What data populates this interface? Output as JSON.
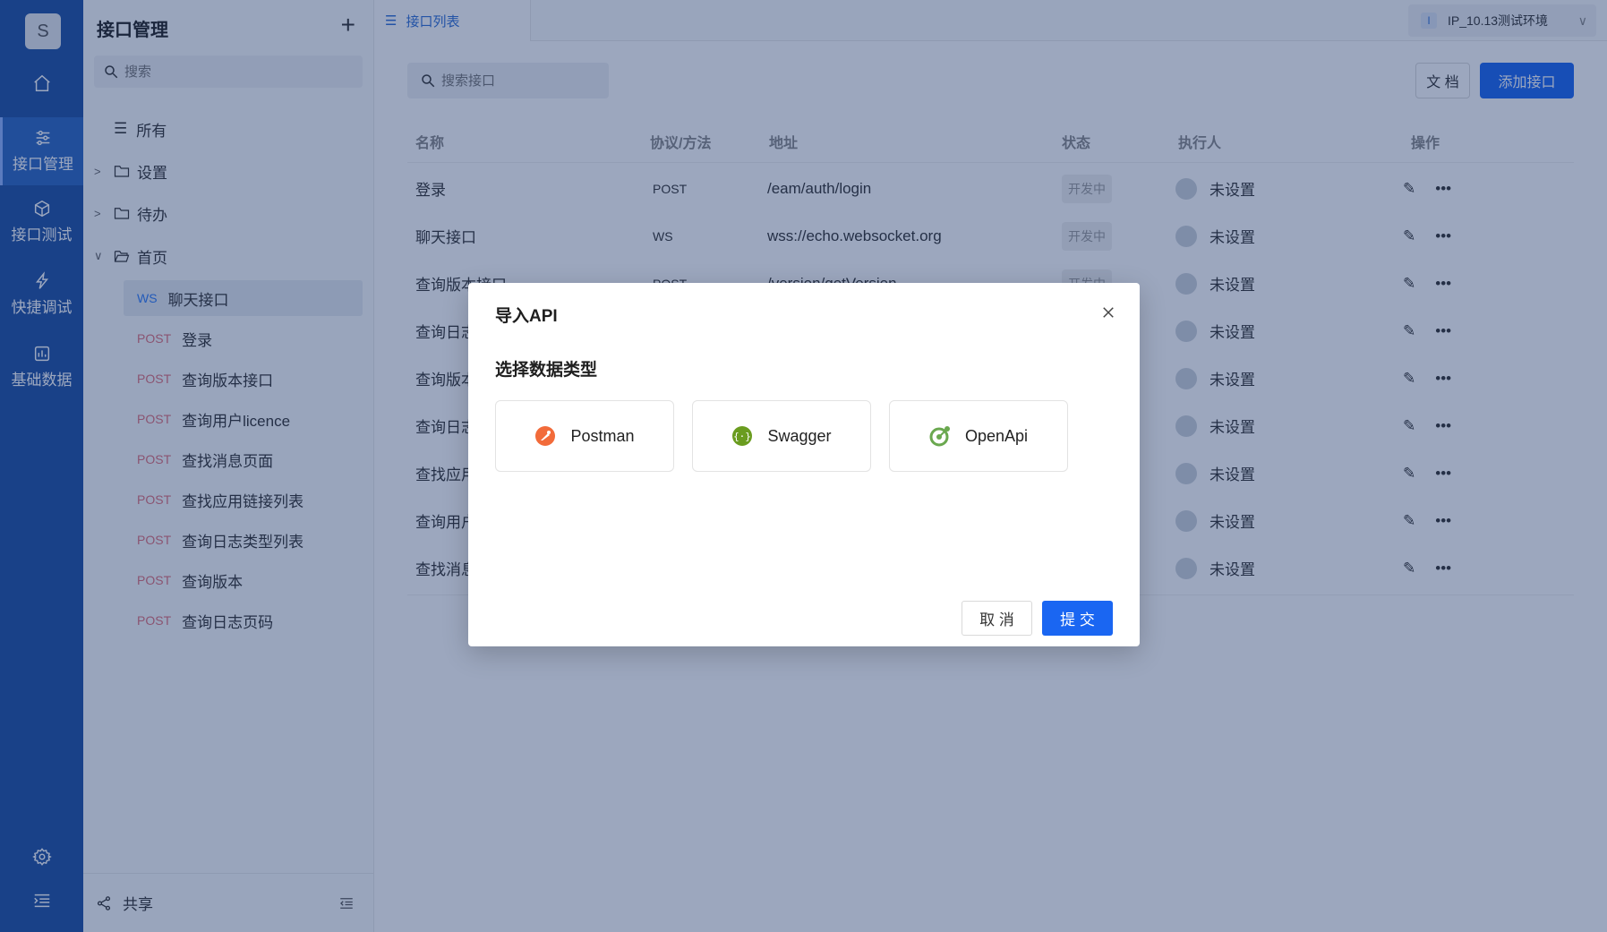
{
  "rail": {
    "avatar": "S",
    "items": [
      {
        "label": "接口管理"
      },
      {
        "label": "接口测试"
      },
      {
        "label": "快捷调试"
      },
      {
        "label": "基础数据"
      }
    ]
  },
  "side": {
    "title": "接口管理",
    "search_placeholder": "搜索",
    "all_label": "所有",
    "folders": [
      "设置",
      "待办",
      "首页"
    ],
    "apis": [
      {
        "method": "WS",
        "name": "聊天接口"
      },
      {
        "method": "POST",
        "name": "登录"
      },
      {
        "method": "POST",
        "name": "查询版本接口"
      },
      {
        "method": "POST",
        "name": "查询用户licence"
      },
      {
        "method": "POST",
        "name": "查找消息页面"
      },
      {
        "method": "POST",
        "name": "查找应用链接列表"
      },
      {
        "method": "POST",
        "name": "查询日志类型列表"
      },
      {
        "method": "POST",
        "name": "查询版本"
      },
      {
        "method": "POST",
        "name": "查询日志页码"
      }
    ],
    "footer_share": "共享"
  },
  "topbar": {
    "tab_label": "接口列表",
    "env_badge": "I",
    "env_label": "IP_10.13测试环境"
  },
  "main": {
    "search_placeholder": "搜索接口",
    "doc_button": "文 档",
    "add_button": "添加接口",
    "headers": {
      "name": "名称",
      "method": "协议/方法",
      "address": "地址",
      "status": "状态",
      "executor": "执行人",
      "ops": "操作"
    },
    "rows": [
      {
        "name": "登录",
        "method": "POST",
        "address": "/eam/auth/login",
        "status": "开发中",
        "executor": "未设置"
      },
      {
        "name": "聊天接口",
        "method": "WS",
        "address": "wss://echo.websocket.org",
        "status": "开发中",
        "executor": "未设置"
      },
      {
        "name": "查询版本接口",
        "method": "POST",
        "address": "/version/getVersion",
        "status": "开发中",
        "executor": "未设置"
      },
      {
        "name": "查询日志",
        "method": "",
        "address": "",
        "status": "",
        "executor": "未设置"
      },
      {
        "name": "查询版本",
        "method": "",
        "address": "",
        "status": "",
        "executor": "未设置"
      },
      {
        "name": "查询日志",
        "method": "",
        "address": "",
        "status": "",
        "executor": "未设置"
      },
      {
        "name": "查找应用",
        "method": "",
        "address": "",
        "status": "",
        "executor": "未设置"
      },
      {
        "name": "查询用户",
        "method": "",
        "address": "",
        "status": "",
        "executor": "未设置"
      },
      {
        "name": "查找消息",
        "method": "",
        "address": "",
        "status": "",
        "executor": "未设置"
      }
    ]
  },
  "modal": {
    "title": "导入API",
    "subtitle": "选择数据类型",
    "types": [
      {
        "label": "Postman",
        "icon": "postman-icon",
        "color": "#f26b3a"
      },
      {
        "label": "Swagger",
        "icon": "swagger-icon",
        "color": "#6a9c1f"
      },
      {
        "label": "OpenApi",
        "icon": "openapi-icon",
        "color": "#6aa84f"
      }
    ],
    "cancel": "取 消",
    "submit": "提 交"
  },
  "colors": {
    "rail": "#1e50a2",
    "primary": "#1a66f2",
    "post": "#e0707a",
    "ws": "#2f7cf6"
  }
}
